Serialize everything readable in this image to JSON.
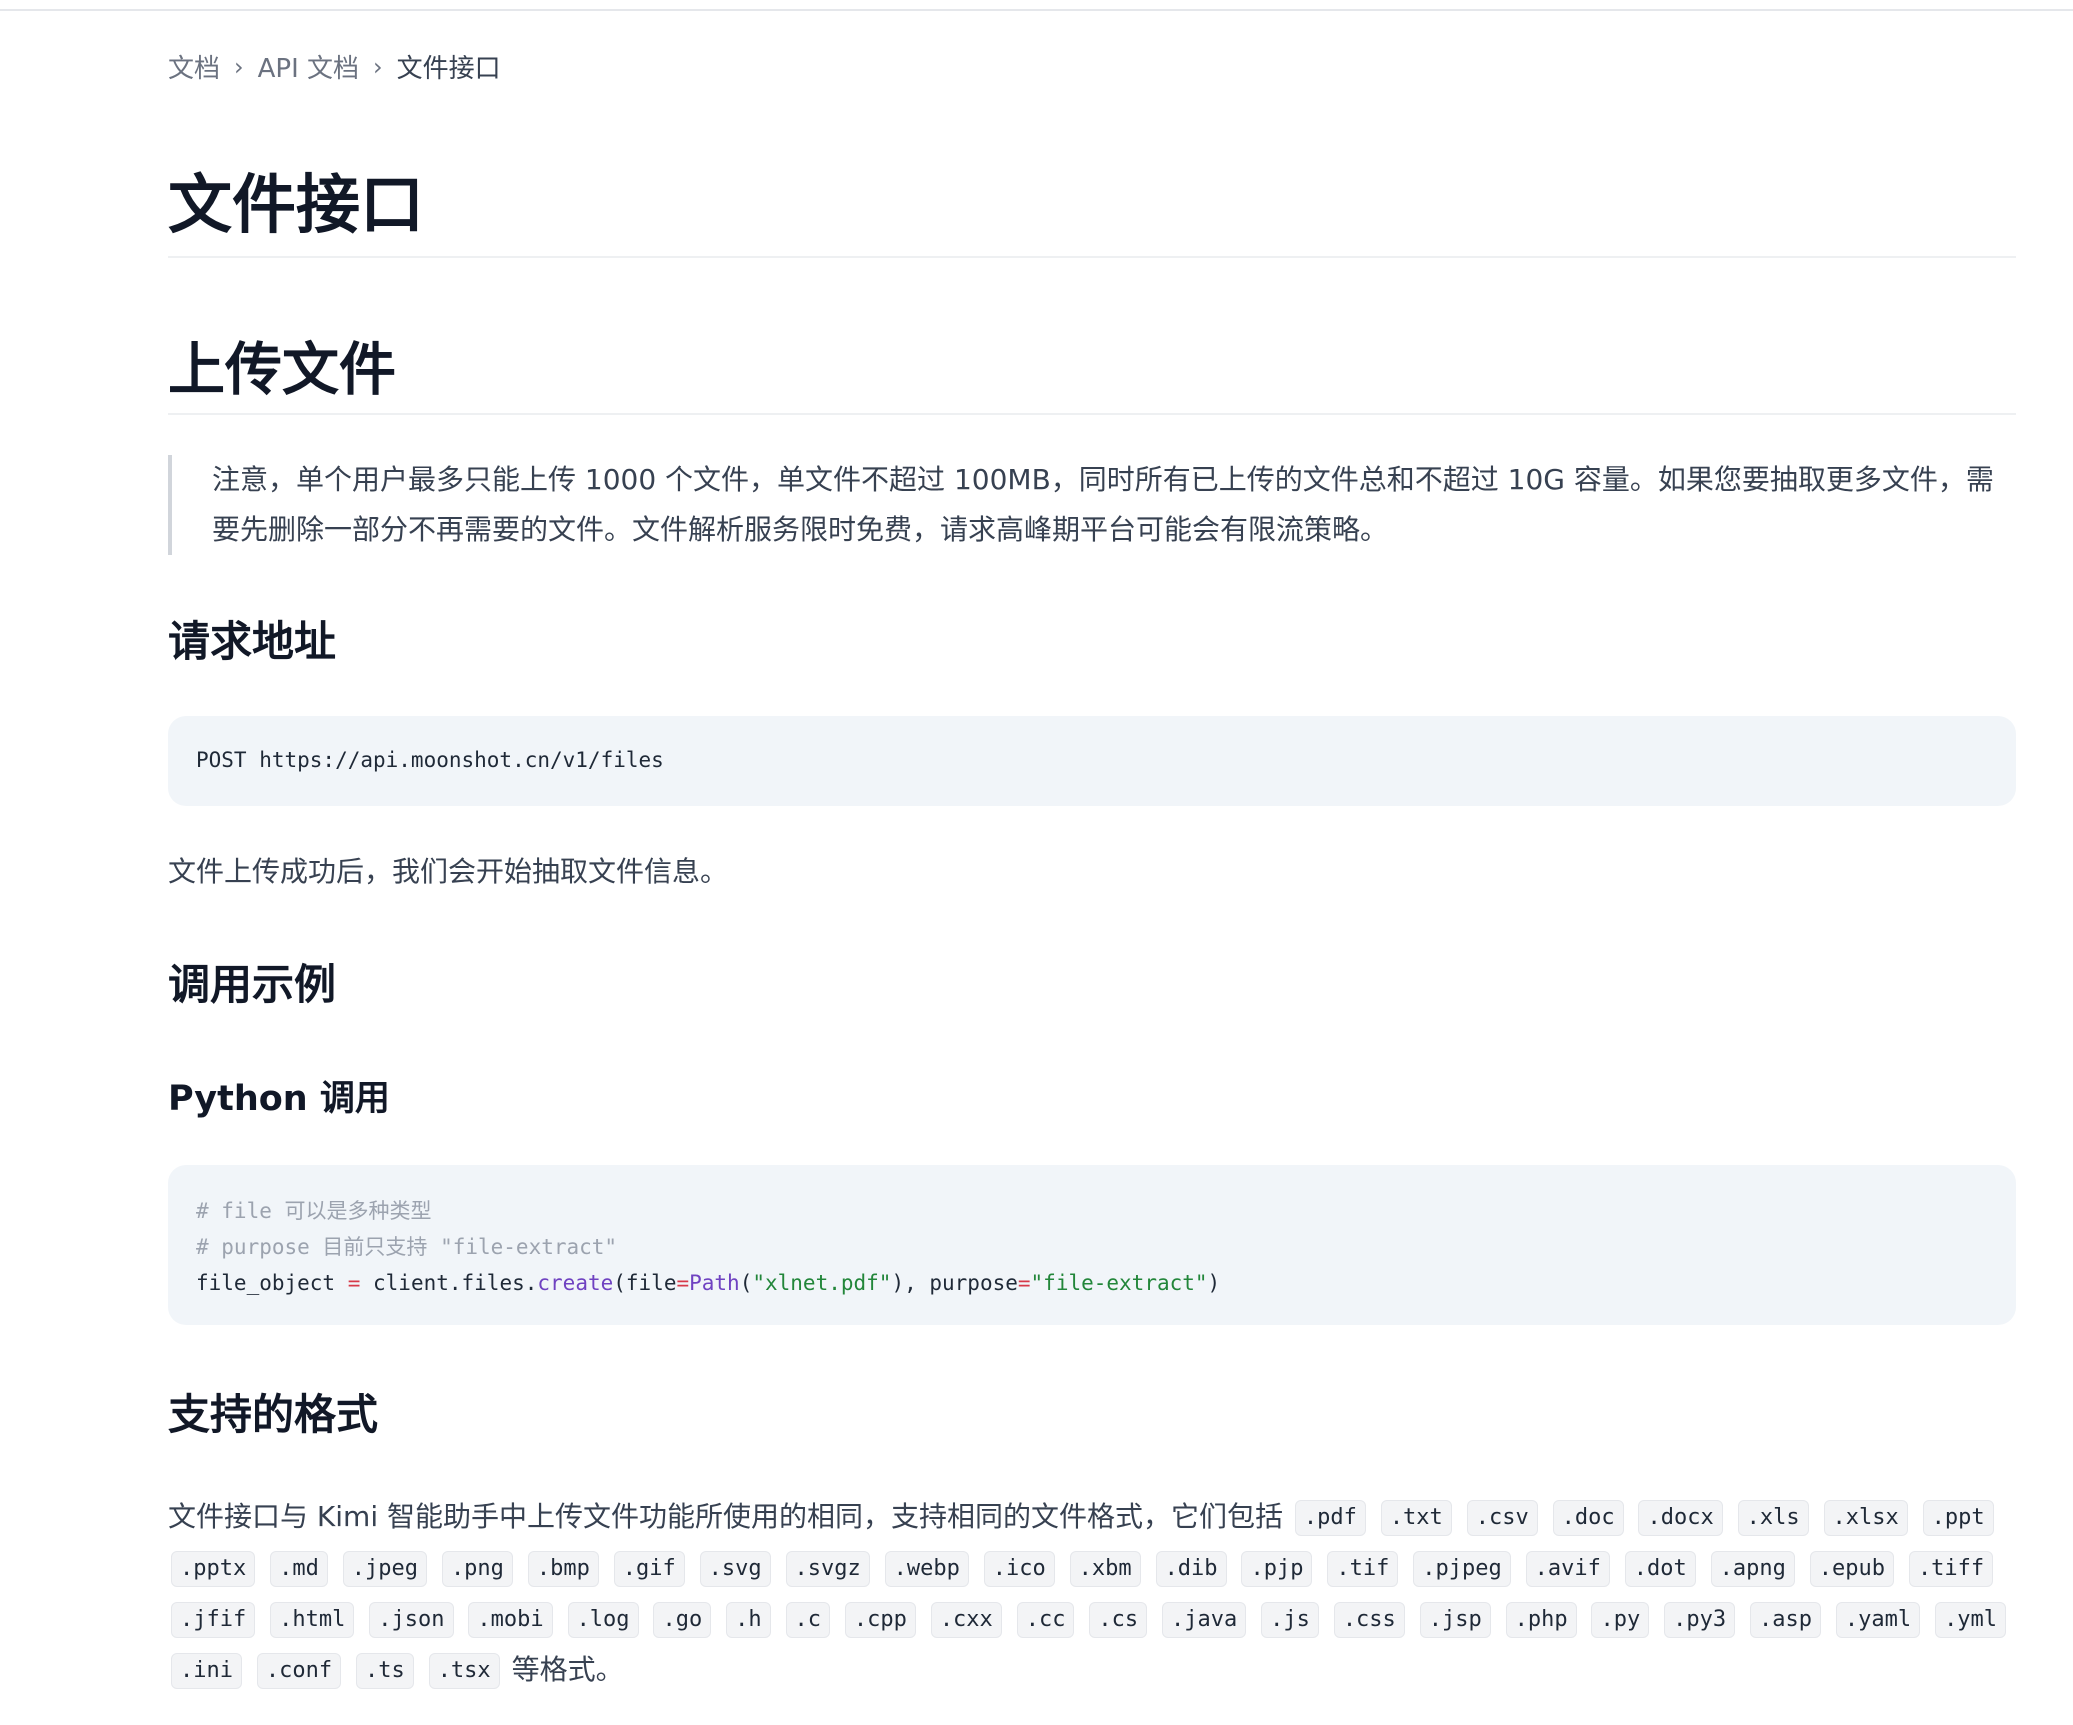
{
  "breadcrumb": {
    "items": [
      "文档",
      "API 文档"
    ],
    "current": "文件接口",
    "separator": "›"
  },
  "page_title": "文件接口",
  "upload_section": {
    "title": "上传文件",
    "notice": "注意，单个用户最多只能上传 1000 个文件，单文件不超过 100MB，同时所有已上传的文件总和不超过 10G 容量。如果您要抽取更多文件，需要先删除一部分不再需要的文件。文件解析服务限时免费，请求高峰期平台可能会有限流策略。"
  },
  "request_url": {
    "title": "请求地址",
    "code": "POST https://api.moonshot.cn/v1/files",
    "description": "文件上传成功后，我们会开始抽取文件信息。"
  },
  "example": {
    "title": "调用示例",
    "python_title": "Python 调用",
    "code": {
      "comment1": "# file 可以是多种类型",
      "comment2": "# purpose 目前只支持 \"file-extract\"",
      "line3_var": "file_object ",
      "line3_eq": "=",
      "line3_client": " client.files.",
      "line3_create": "create",
      "line3_open": "(file",
      "line3_eq2": "=",
      "line3_path": "Path",
      "line3_paren": "(",
      "line3_str1": "\"xlnet.pdf\"",
      "line3_mid": "), purpose",
      "line3_eq3": "=",
      "line3_str2": "\"file-extract\"",
      "line3_close": ")"
    }
  },
  "formats": {
    "title": "支持的格式",
    "intro": "文件接口与 Kimi 智能助手中上传文件功能所使用的相同，支持相同的文件格式，它们包括",
    "extensions": [
      ".pdf",
      ".txt",
      ".csv",
      ".doc",
      ".docx",
      ".xls",
      ".xlsx",
      ".ppt",
      ".pptx",
      ".md",
      ".jpeg",
      ".png",
      ".bmp",
      ".gif",
      ".svg",
      ".svgz",
      ".webp",
      ".ico",
      ".xbm",
      ".dib",
      ".pjp",
      ".tif",
      ".pjpeg",
      ".avif",
      ".dot",
      ".apng",
      ".epub",
      ".tiff",
      ".jfif",
      ".html",
      ".json",
      ".mobi",
      ".log",
      ".go",
      ".h",
      ".c",
      ".cpp",
      ".cxx",
      ".cc",
      ".cs",
      ".java",
      ".js",
      ".css",
      ".jsp",
      ".php",
      ".py",
      ".py3",
      ".asp",
      ".yaml",
      ".yml",
      ".ini",
      ".conf",
      ".ts",
      ".tsx"
    ],
    "outro": "等格式。"
  }
}
